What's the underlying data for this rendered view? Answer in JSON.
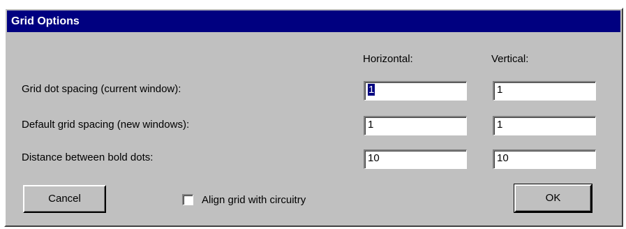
{
  "dialog": {
    "title": "Grid Options"
  },
  "columns": {
    "horizontal": "Horizontal:",
    "vertical": "Vertical:"
  },
  "rows": [
    {
      "label": "Grid dot spacing (current window):",
      "horizontal": "1",
      "vertical": "1"
    },
    {
      "label": "Default grid spacing (new windows):",
      "horizontal": "1",
      "vertical": "1"
    },
    {
      "label": "Distance between bold dots:",
      "horizontal": "10",
      "vertical": "10"
    }
  ],
  "buttons": {
    "cancel": "Cancel",
    "ok": "OK"
  },
  "checkbox": {
    "label": "Align grid with circuitry",
    "checked": false
  },
  "colors": {
    "face": "#c0c0c0",
    "titlebar": "#000080",
    "selection": "#000080"
  }
}
